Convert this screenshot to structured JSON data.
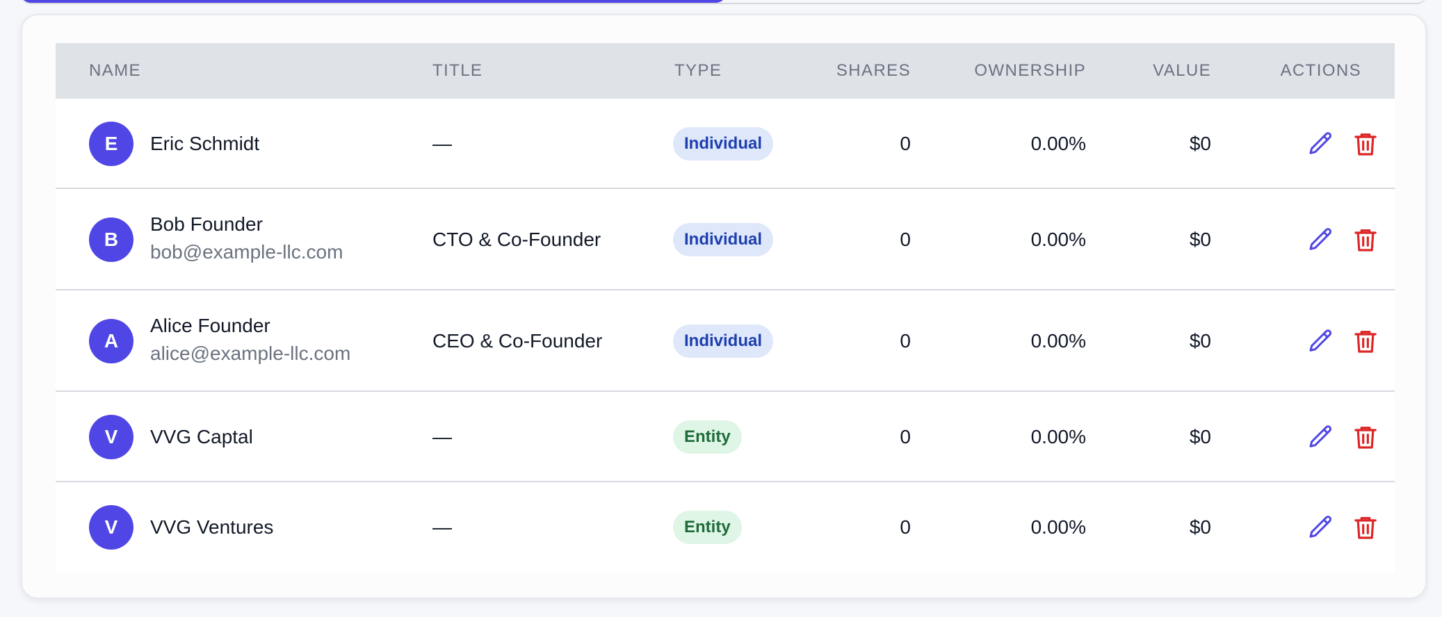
{
  "colors": {
    "accent": "#4f46e5",
    "delete": "#dc2626",
    "header_bg": "#dfe2e7",
    "individual_badge_bg": "#dfe7fb",
    "individual_badge_text": "#1e40af",
    "entity_badge_bg": "#dff5e6",
    "entity_badge_text": "#1f6b3a"
  },
  "table": {
    "headers": {
      "name": "NAME",
      "title": "TITLE",
      "type": "TYPE",
      "shares": "SHARES",
      "ownership": "OWNERSHIP",
      "value": "VALUE",
      "actions": "ACTIONS"
    },
    "rows": [
      {
        "initial": "E",
        "name": "Eric Schmidt",
        "email": "",
        "title": "—",
        "type": "Individual",
        "shares": "0",
        "ownership": "0.00%",
        "value": "$0",
        "edit_icon": "pencil-icon",
        "delete_icon": "trash-icon"
      },
      {
        "initial": "B",
        "name": "Bob Founder",
        "email": "bob@example-llc.com",
        "title": "CTO & Co-Founder",
        "type": "Individual",
        "shares": "0",
        "ownership": "0.00%",
        "value": "$0",
        "edit_icon": "pencil-icon",
        "delete_icon": "trash-icon"
      },
      {
        "initial": "A",
        "name": "Alice Founder",
        "email": "alice@example-llc.com",
        "title": "CEO & Co-Founder",
        "type": "Individual",
        "shares": "0",
        "ownership": "0.00%",
        "value": "$0",
        "edit_icon": "pencil-icon",
        "delete_icon": "trash-icon"
      },
      {
        "initial": "V",
        "name": "VVG Captal",
        "email": "",
        "title": "—",
        "type": "Entity",
        "shares": "0",
        "ownership": "0.00%",
        "value": "$0",
        "edit_icon": "pencil-icon",
        "delete_icon": "trash-icon"
      },
      {
        "initial": "V",
        "name": "VVG Ventures",
        "email": "",
        "title": "—",
        "type": "Entity",
        "shares": "0",
        "ownership": "0.00%",
        "value": "$0",
        "edit_icon": "pencil-icon",
        "delete_icon": "trash-icon"
      }
    ]
  }
}
